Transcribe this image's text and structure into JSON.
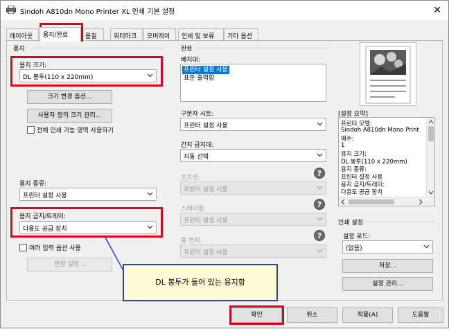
{
  "window": {
    "title": "Sindoh A810dn Mono Printer XL 인쇄 기본 설정",
    "close_glyph": "✕"
  },
  "tabs": [
    {
      "label": "레이아웃",
      "active": false
    },
    {
      "label": "용지/완료",
      "active": true
    },
    {
      "label": "품질",
      "active": false
    },
    {
      "label": "워터마크",
      "active": false
    },
    {
      "label": "오버레이",
      "active": false
    },
    {
      "label": "인쇄 및 보류",
      "active": false
    },
    {
      "label": "기타 옵션",
      "active": false
    }
  ],
  "paper": {
    "group_label": "용지",
    "size_label": "용지 크기:",
    "size_value": "DL 봉투(110 x 220mm)",
    "resize_options_button": "크기 변경 옵션...",
    "custom_size_button": "사용자 정의 크기 관리...",
    "full_area_checkbox": "전체 인쇄 가능 영역 사용하기",
    "type_label": "용지 종류:",
    "type_value": "프린터 설정 사용",
    "source_label": "용지 급지/트레이:",
    "source_value": "다용도 공급 장치",
    "multiple_input_checkbox": "여러 입력 옵션 사용",
    "edit_settings_button": "편집 설정..."
  },
  "finishing": {
    "group_label": "완료",
    "output_label": "배지대:",
    "output_items": [
      {
        "label": "프린터 설정 사용",
        "selected": true
      },
      {
        "label": "표준 출력함",
        "selected": false
      }
    ],
    "separator_label": "구분자 시트:",
    "separator_value": "프린터 설정 사용",
    "interleave_label": "간지 급지대:",
    "interleave_value": "자동 선택",
    "offset_label": "오프셋:",
    "offset_value": "프린터 설정 사용",
    "staple_label": "스테이플:",
    "staple_value": "프린터 설정 사용",
    "punch_label": "홈 펀치:",
    "punch_value": "프린터 설정 사용",
    "help_glyph": "?"
  },
  "summary": {
    "label": "[설정 요약]",
    "lines": [
      "프린터 모델:",
      "   Sindoh A810dn Mono Print",
      "매수:",
      "   1",
      "용지 크기:",
      "   DL 봉투(110 x 220mm)",
      "용지 종류:",
      "   프린터 설정 사용",
      "용지 급지/트레이:",
      "   다용도 공급 장치"
    ]
  },
  "print_settings": {
    "group_label": "인쇄 설정",
    "load_label": "설정 로드:",
    "load_value": "(없음)",
    "save_button": "저장...",
    "manage_button": "설정 관리..."
  },
  "callout": {
    "text": "DL 봉투가 들어 있는 용지함"
  },
  "bottom": {
    "ok": "확인",
    "cancel": "취소",
    "apply": "적용(A)",
    "help": "도움말"
  },
  "colors": {
    "highlight": "#e2001a",
    "callout_border": "#2f3fc4",
    "callout_fill": "#fffbd6",
    "selection": "#0078d7"
  }
}
